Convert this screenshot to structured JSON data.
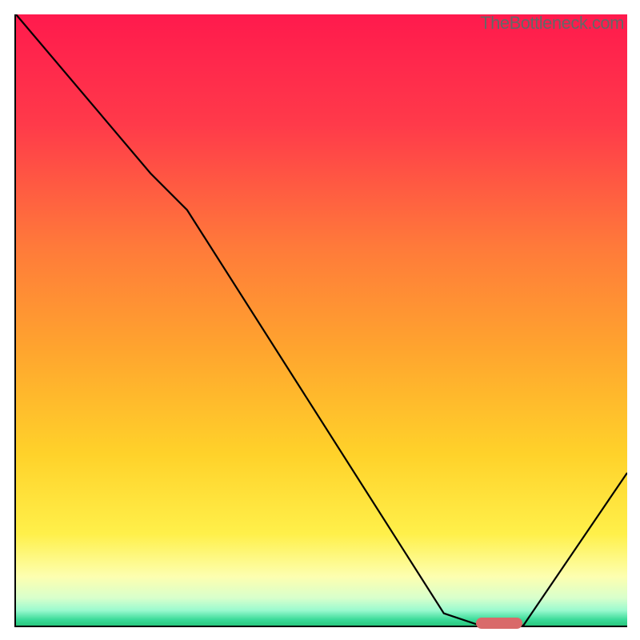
{
  "watermark": "TheBottleneck.com",
  "chart_data": {
    "type": "line",
    "title": "",
    "xlabel": "",
    "ylabel": "",
    "xlim": [
      0,
      100
    ],
    "ylim": [
      0,
      100
    ],
    "x": [
      0,
      22,
      28,
      70,
      76,
      83,
      100
    ],
    "y": [
      100,
      74,
      68,
      2,
      0,
      0,
      25
    ],
    "marker_x": 79,
    "marker_y": 0,
    "gradient_stops": [
      {
        "pos": 0.0,
        "color": "#ff1a4d"
      },
      {
        "pos": 0.18,
        "color": "#ff3a4a"
      },
      {
        "pos": 0.38,
        "color": "#ff7a3a"
      },
      {
        "pos": 0.55,
        "color": "#ffa52e"
      },
      {
        "pos": 0.72,
        "color": "#ffd22a"
      },
      {
        "pos": 0.85,
        "color": "#fff04a"
      },
      {
        "pos": 0.92,
        "color": "#fdffb0"
      },
      {
        "pos": 0.955,
        "color": "#d8ffcc"
      },
      {
        "pos": 0.975,
        "color": "#9afacf"
      },
      {
        "pos": 0.99,
        "color": "#3cdb9a"
      },
      {
        "pos": 1.0,
        "color": "#28c77d"
      }
    ]
  }
}
